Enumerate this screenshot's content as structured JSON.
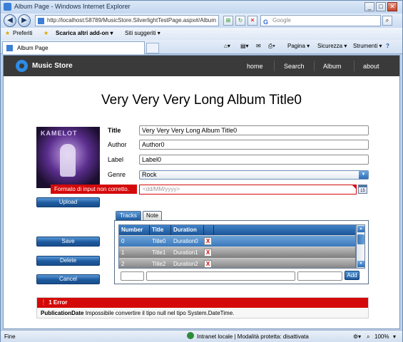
{
  "window": {
    "title": "Album Page - Windows Internet Explorer",
    "min": "_",
    "max": "□",
    "close": "✕"
  },
  "address": {
    "url": "http://localhost:58789/MusicStore.SilverlightTestPage.aspx#/Album",
    "search_placeholder": "Google"
  },
  "favorites": {
    "preferiti": "Preferiti",
    "addon": "Scarica altri add-on ▾",
    "siti": "Siti suggeriti ▾"
  },
  "tab": {
    "label": "Album Page"
  },
  "commands": {
    "pagina": "Pagina ▾",
    "sicurezza": "Sicurezza ▾",
    "strumenti": "Strumenti ▾",
    "help": "?"
  },
  "app": {
    "brand": "Music Store",
    "nav": [
      "home",
      "Search",
      "Album",
      "about"
    ],
    "title": "Very Very Very Long Album Title0",
    "cover_text": "KAMELOT",
    "fields": {
      "title_label": "Title",
      "title_value": "Very Very Very Long Album Title0",
      "author_label": "Author",
      "author_value": "Author0",
      "label_label": "Label",
      "label_value": "Label0",
      "genre_label": "Genre",
      "genre_value": "Rock",
      "date_placeholder": "<dd/MM/yyyy>",
      "date_error": "Formato di input non corretto.",
      "calendar_day": "15"
    },
    "buttons": {
      "upload": "Upload",
      "save": "Save",
      "delete": "Delete",
      "cancel": "Cancel",
      "add": "Add"
    },
    "track_tabs": [
      "Tracks",
      "Note"
    ],
    "grid": {
      "headers": [
        "Number",
        "Title",
        "Duration"
      ],
      "rows": [
        {
          "number": "0",
          "title": "Title0",
          "duration": "Duration0",
          "remove": "X"
        },
        {
          "number": "1",
          "title": "Title1",
          "duration": "Duration1",
          "remove": "X"
        },
        {
          "number": "2",
          "title": "Title2",
          "duration": "Duration2",
          "remove": "X"
        }
      ]
    },
    "errors": {
      "header": "1 Error",
      "field": "PublicationDate",
      "message": "Impossibile convertire il tipo null nel tipo System.DateTime."
    }
  },
  "statusbar": {
    "left": "Fine",
    "zone": "Intranet locale | Modalità protetta: disattivata",
    "zoom": "100%"
  }
}
